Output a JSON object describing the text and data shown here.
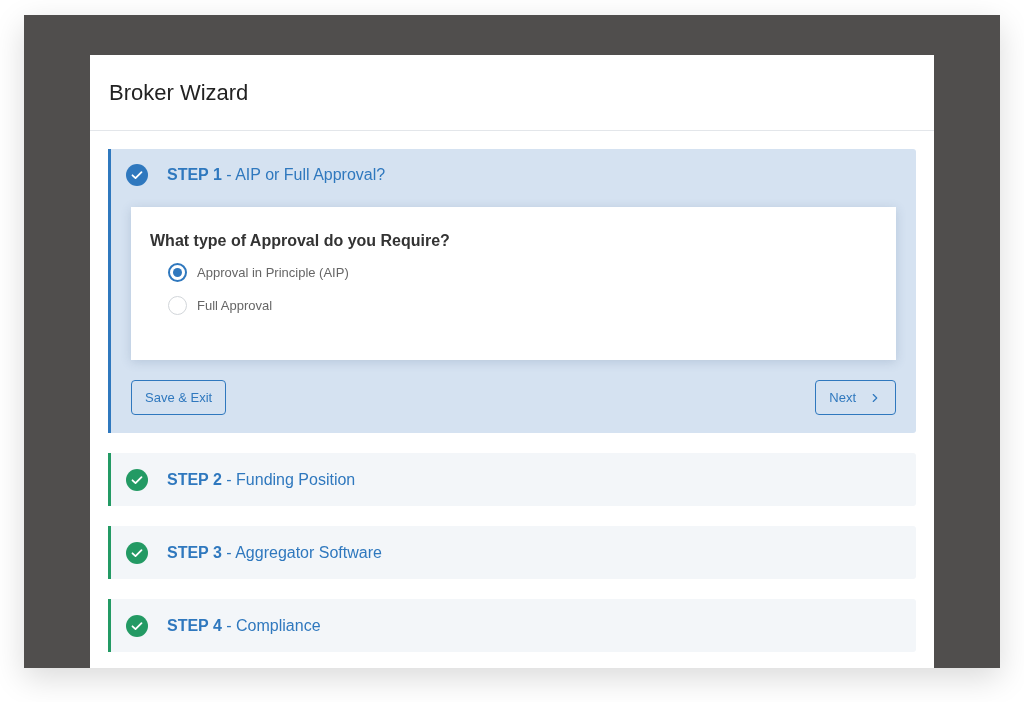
{
  "window": {
    "title": "Broker Wizard"
  },
  "steps": [
    {
      "title": "**STEP 1** - AIP or Full Approval?",
      "expanded": true,
      "question": "What type of Approval do you Require?",
      "options": [
        {
          "label": "Approval in Principle (AIP)",
          "selected": true
        },
        {
          "label": "Full Approval",
          "selected": false
        }
      ],
      "buttons": {
        "save": "Save & Exit",
        "next": "Next"
      }
    },
    {
      "title": "**STEP 2** - Funding Position",
      "expanded": false
    },
    {
      "title": "**STEP 3** - Aggregator Software",
      "expanded": false
    },
    {
      "title": "**STEP 4** - Compliance",
      "expanded": false
    }
  ]
}
